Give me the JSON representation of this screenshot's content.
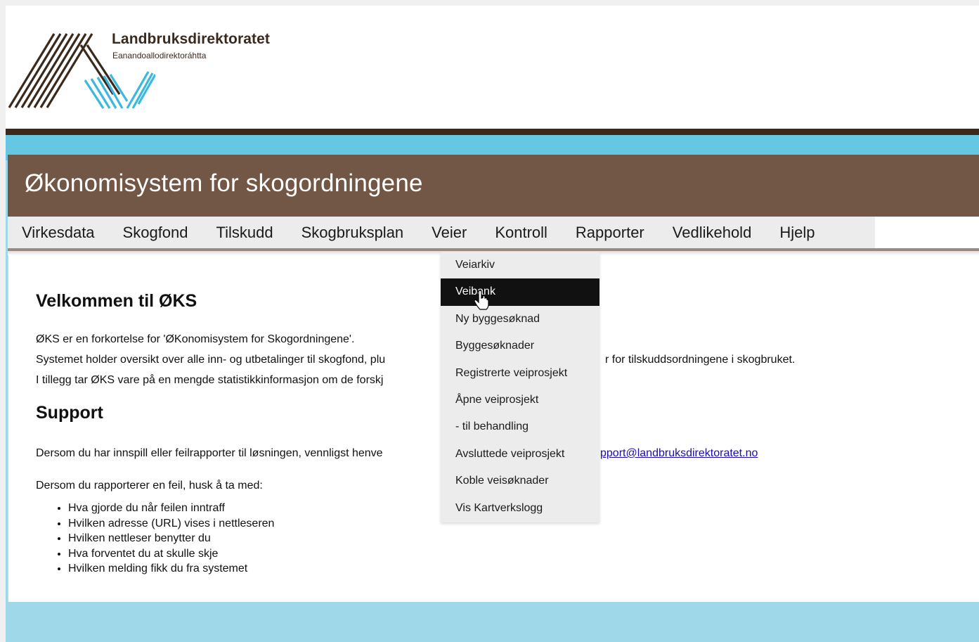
{
  "brand": {
    "name": "Landbruksdirektoratet",
    "subname": "Eanandoallodirektoráhtta"
  },
  "app": {
    "title": "Økonomisystem for skogordningene"
  },
  "nav": {
    "items": [
      {
        "label": "Virkesdata"
      },
      {
        "label": "Skogfond"
      },
      {
        "label": "Tilskudd"
      },
      {
        "label": "Skogbruksplan"
      },
      {
        "label": "Veier"
      },
      {
        "label": "Kontroll"
      },
      {
        "label": "Rapporter"
      },
      {
        "label": "Vedlikehold"
      },
      {
        "label": "Hjelp"
      }
    ],
    "active": "Veier"
  },
  "dropdown": {
    "items": [
      {
        "label": "Veiarkiv"
      },
      {
        "label": "Veibank"
      },
      {
        "label": "Ny byggesøknad"
      },
      {
        "label": "Byggesøknader"
      },
      {
        "label": "Registrerte veiprosjekt"
      },
      {
        "label": "Åpne veiprosjekt"
      },
      {
        "label": "- til behandling"
      },
      {
        "label": "Avsluttede veiprosjekt"
      },
      {
        "label": "Koble veisøknader"
      },
      {
        "label": "Vis Kartverkslogg"
      }
    ],
    "hovered": "Veibank"
  },
  "content": {
    "welcome_heading": "Velkommen til ØKS",
    "intro_line_1": "ØKS er en forkortelse for 'ØKonomisystem for Skogordningene'.",
    "intro_line_2_left": "Systemet holder oversikt over alle inn- og utbetalinger til skogfond, plu",
    "intro_line_2_right": "r for tilskuddsordningene i skogbruket.",
    "intro_line_3": "I tillegg tar ØKS vare på en mengde statistikkinformasjon om de forskj",
    "support_heading": "Support",
    "support_text": "Dersom du har innspill eller feilrapporter til løsningen, vennligst henve",
    "support_email": "pport@landbruksdirektoratet.no",
    "report_intro": "Dersom du rapporterer en feil, husk å ta med:",
    "checklist": [
      "Hva gjorde du når feilen inntraff",
      "Hvilken adresse (URL) vises i nettleseren",
      "Hvilken nettleser benytter du",
      "Hva forventet du at skulle skje",
      "Hvilken melding fikk du fra systemet"
    ]
  },
  "colors": {
    "header_brown": "#725646",
    "strip_dark": "#3b2a1c",
    "sky_blue": "#66c7e2",
    "light_blue": "#9fd9e9",
    "menu_bg": "#ececec",
    "hover_bg": "#111111",
    "link": "#1a0dab"
  },
  "icons": {
    "logo": "landbruksdirektoratet-logo",
    "cursor": "hand-pointer-cursor"
  }
}
